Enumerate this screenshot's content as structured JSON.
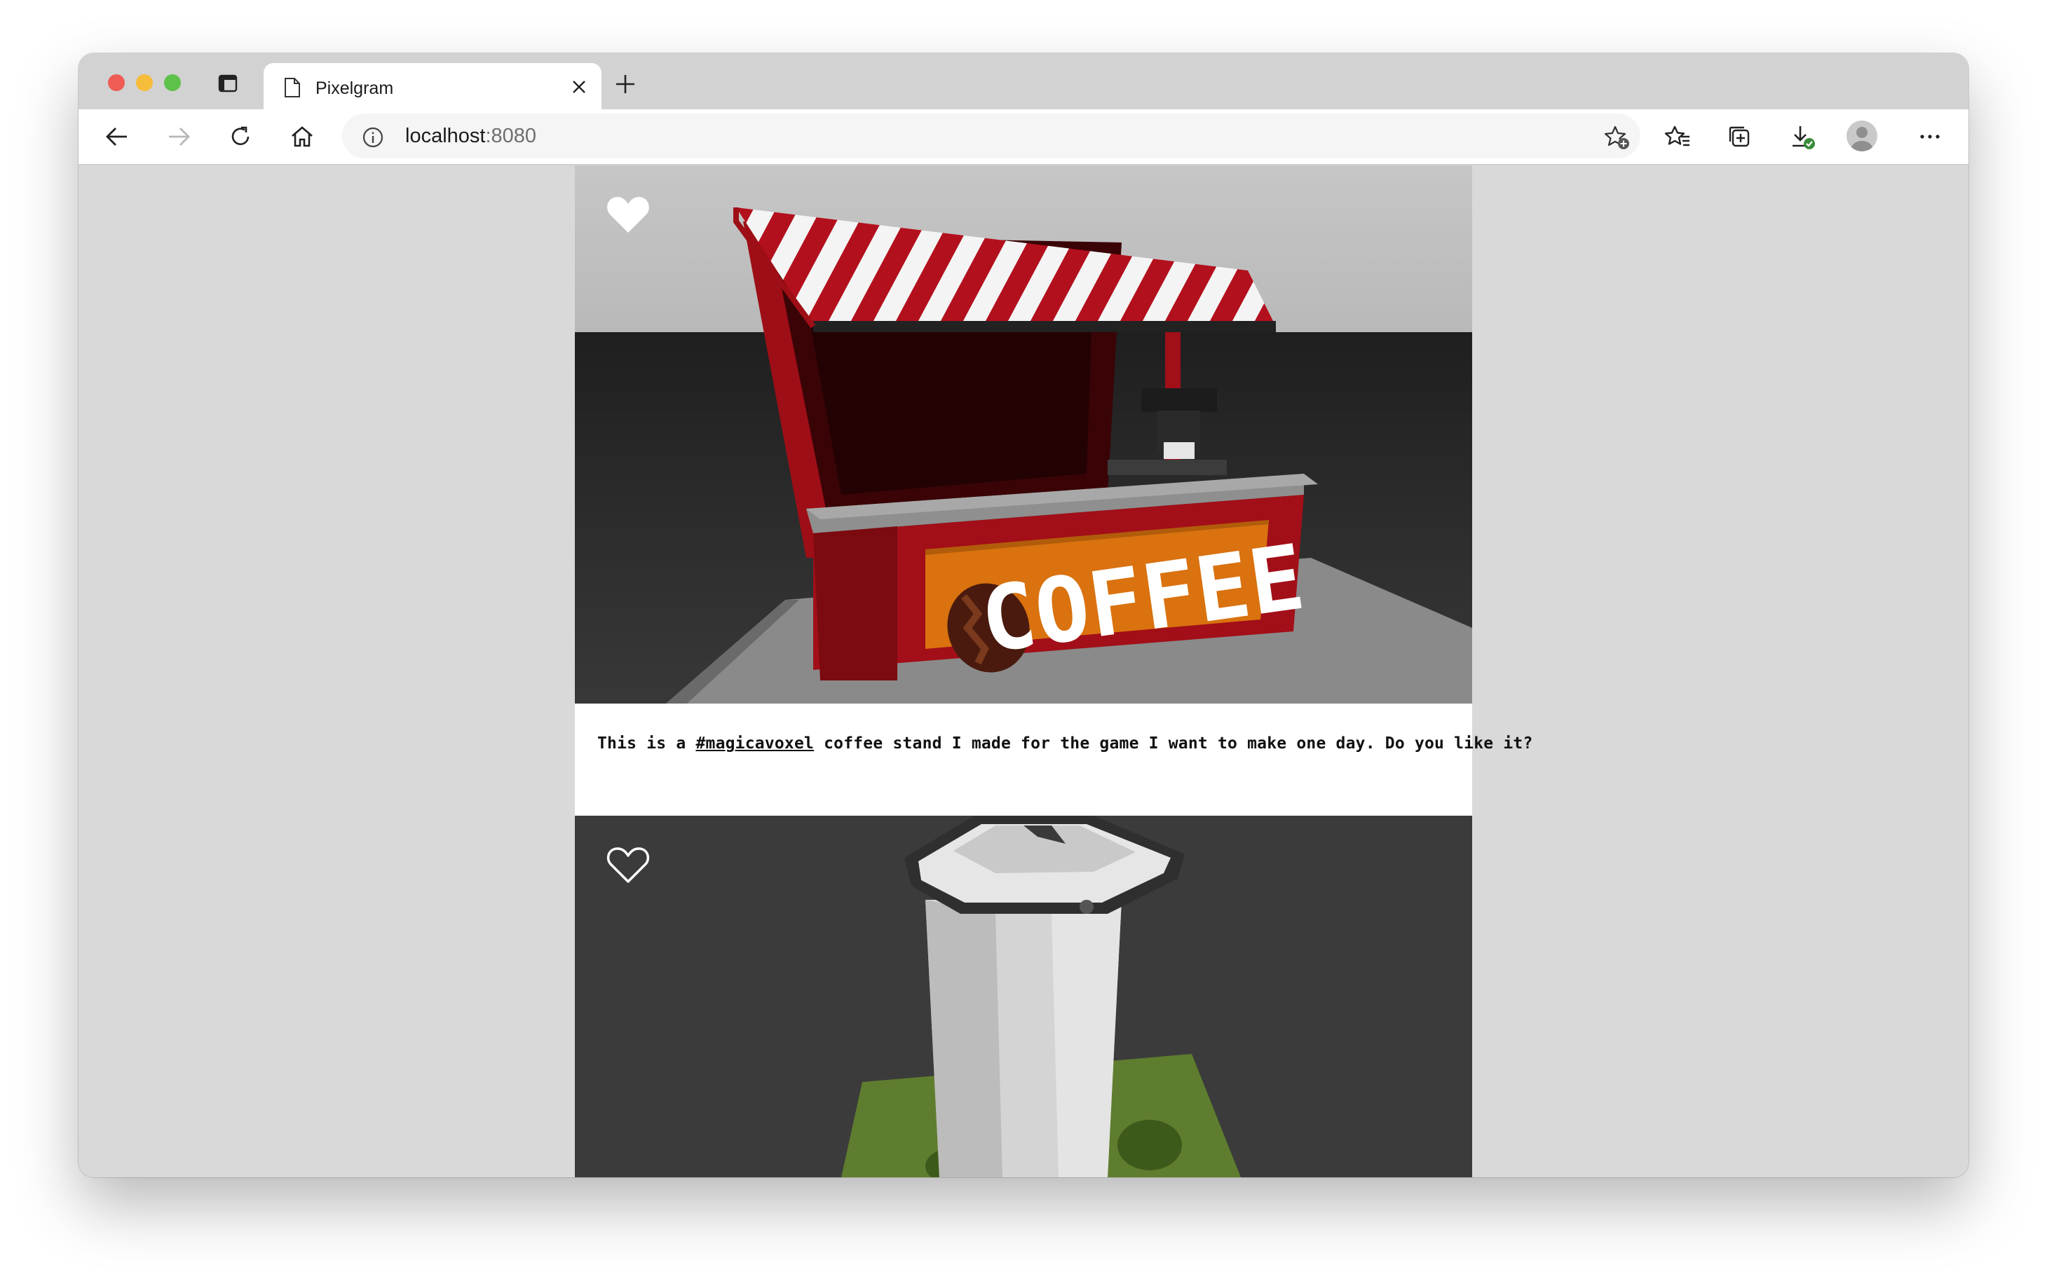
{
  "browser": {
    "tab": {
      "title": "Pixelgram",
      "icon": "page-icon"
    },
    "address_bar": {
      "host": "localhost",
      "port": ":8080",
      "icon": "info-icon"
    },
    "toolbar_icons": [
      "back-icon",
      "forward-icon",
      "refresh-icon",
      "home-icon",
      "add-favorite-icon",
      "favorites-icon",
      "collections-icon",
      "downloads-icon",
      "profile-icon",
      "more-icon"
    ]
  },
  "feed": {
    "posts": [
      {
        "liked": true,
        "image": "voxel coffee stand",
        "sign_text": "COFFEE",
        "caption": {
          "prefix": "This is a ",
          "hashtag": "#magicavoxel",
          "suffix": " coffee stand I made for the game I want to make one day. Do you like it?"
        }
      },
      {
        "liked": false,
        "image": "voxel white tower"
      }
    ]
  },
  "colors": {
    "page_background": "#d9d9d9",
    "awning_red": "#b3101d",
    "sign_orange": "#e07a12"
  }
}
